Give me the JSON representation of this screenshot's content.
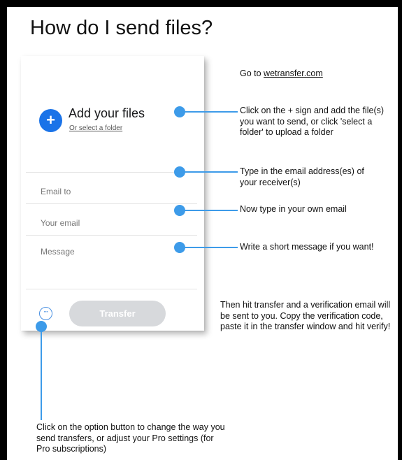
{
  "title": "How do I send files?",
  "panel": {
    "add_files_label": "Add your files",
    "add_plus": "+",
    "select_folder_label": "Or select a folder",
    "email_to_placeholder": "Email to",
    "your_email_placeholder": "Your email",
    "message_placeholder": "Message",
    "options_glyph": "···",
    "transfer_label": "Transfer"
  },
  "notes": {
    "goto_prefix": "Go to ",
    "goto_link": "wetransfer.com",
    "add_files": "Click on the + sign and add the file(s) you want to send, or click 'select a folder' to upload a folder",
    "email_to": "Type in the email address(es) of your receiver(s)",
    "your_email": "Now type in your own email",
    "message": "Write a short message if you want!",
    "transfer": "Then hit transfer and a verification email will be sent to you. Copy the verification code, paste it in the transfer window and hit verify!",
    "options": "Click on the option button to change the way you send transfers, or adjust your Pro settings (for Pro subscriptions)"
  },
  "colors": {
    "connector": "#3d9be9",
    "add_button": "#1a73e8",
    "transfer_button": "#d7d9dc"
  }
}
